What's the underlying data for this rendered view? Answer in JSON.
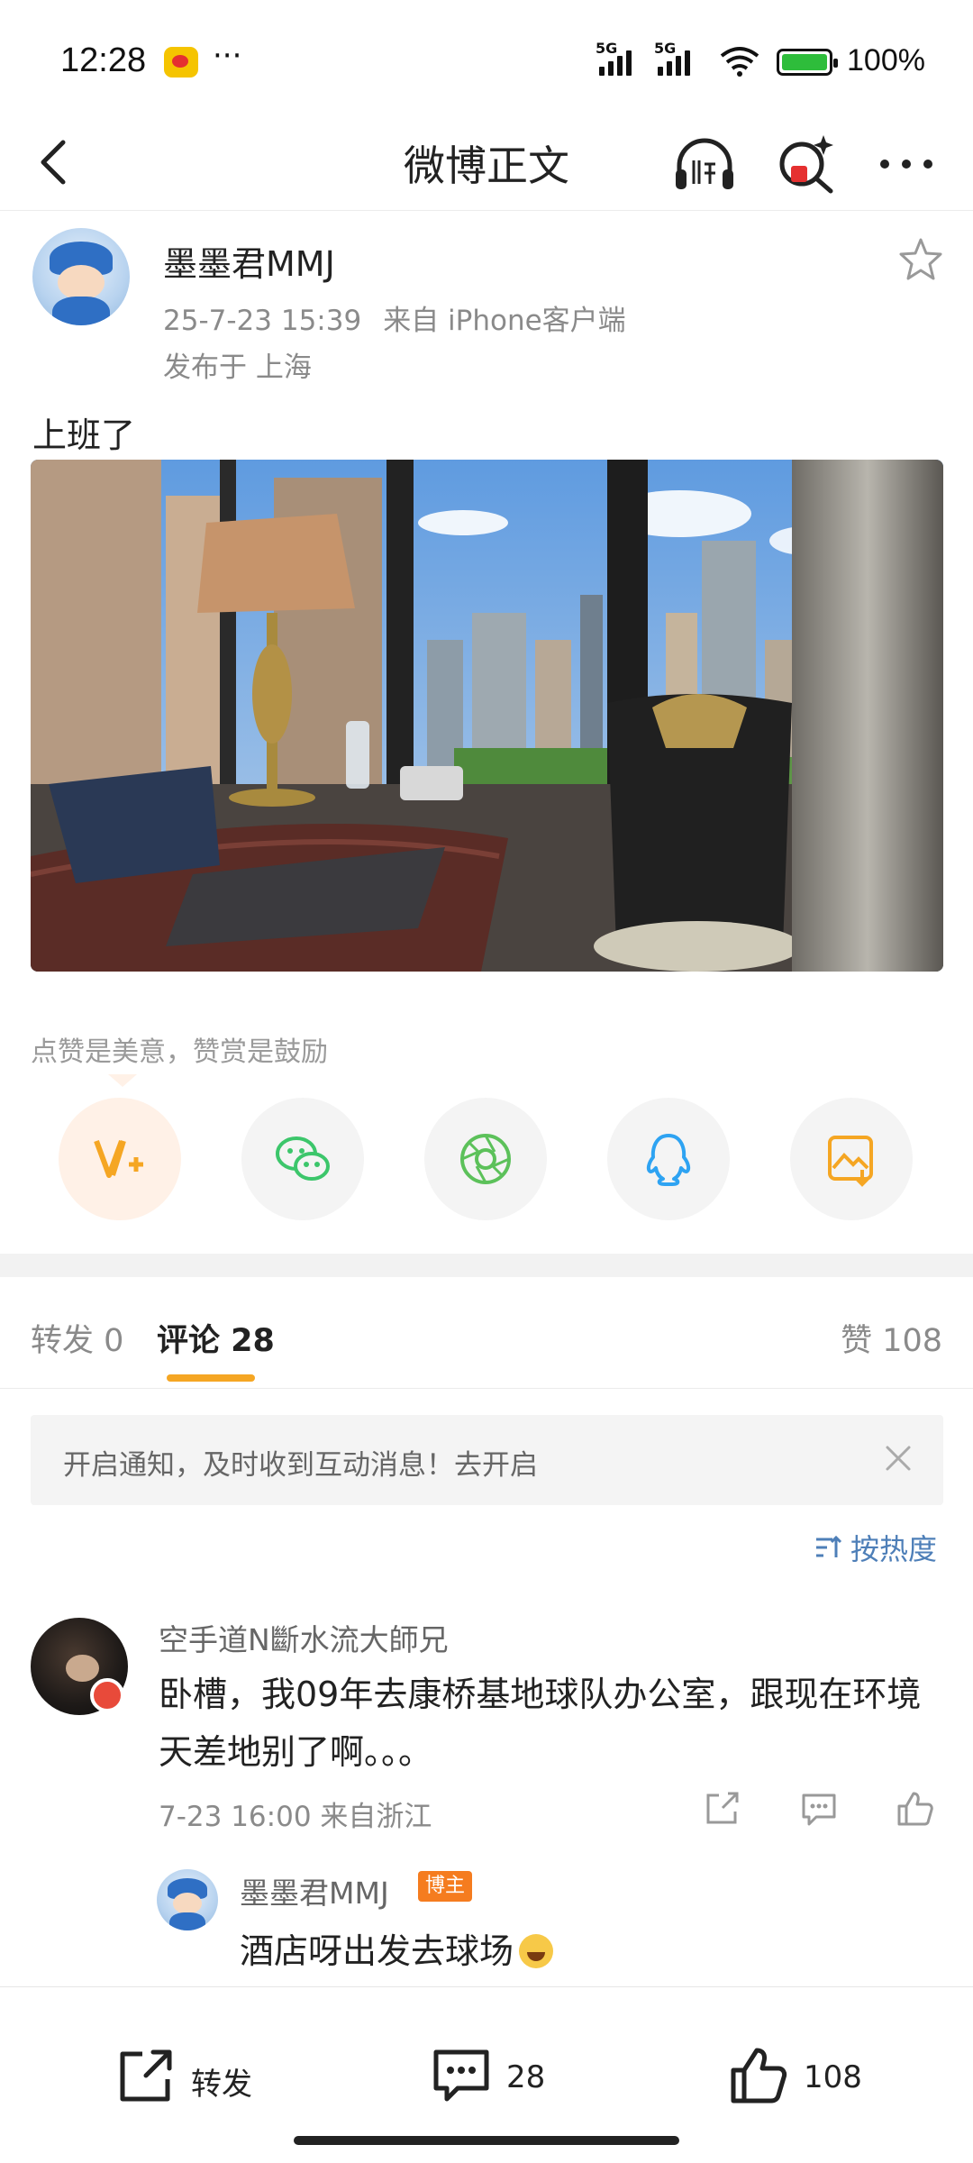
{
  "status_bar": {
    "time": "12:28",
    "more": "···",
    "signal1_label": "5G",
    "signal2_label": "5G",
    "battery": "100%"
  },
  "header": {
    "title": "微博正文",
    "listen_icon": "headphones-icon",
    "ai_icon": "magic-search-icon",
    "more_icon": "more-icon"
  },
  "post": {
    "user": "墨墨君MMJ",
    "date": "25-7-23 15:39",
    "source": "来自 iPhone客户端",
    "location": "发布于 上海",
    "text": "上班了",
    "photo_icon": "office-window-photo"
  },
  "encourage": {
    "text": "点赞是美意，赞赏是鼓励",
    "buttons": [
      {
        "name": "vplus-reward",
        "color": "#f5a623"
      },
      {
        "name": "wechat",
        "color": "#3cc66b"
      },
      {
        "name": "moments",
        "color": "#5cc15a"
      },
      {
        "name": "qq",
        "color": "#2ea3f2"
      },
      {
        "name": "save-image",
        "color": "#f5a623"
      }
    ]
  },
  "tabs": {
    "repost": "转发 0",
    "comment": "评论 28",
    "like": "赞 108"
  },
  "notice": {
    "text": "开启通知，及时收到互动消息！去开启"
  },
  "sort": {
    "label": "按热度"
  },
  "comment": {
    "user": "空手道N斷水流大師兄",
    "text": "卧槽，我09年去康桥基地球队办公室，跟现在环境天差地别了啊。。。",
    "meta": "7-23 16:00 来自浙江"
  },
  "reply": {
    "user": "墨墨君MMJ",
    "badge": "博主",
    "text": "酒店呀出发去球场"
  },
  "bottom_bar": {
    "repost": "转发",
    "comments": "28",
    "likes": "108"
  },
  "colors": {
    "accent": "#f5a623",
    "link": "#4e7fb8"
  }
}
